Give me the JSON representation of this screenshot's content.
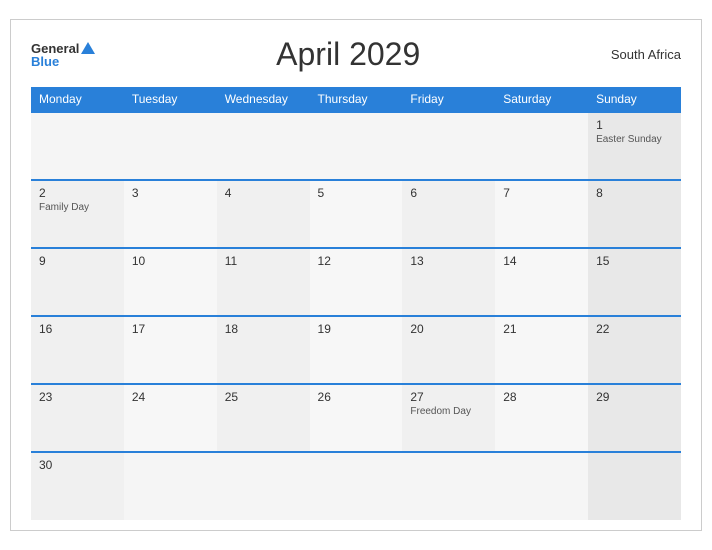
{
  "header": {
    "logo_general": "General",
    "logo_blue": "Blue",
    "month_title": "April 2029",
    "country": "South Africa"
  },
  "weekdays": [
    "Monday",
    "Tuesday",
    "Wednesday",
    "Thursday",
    "Friday",
    "Saturday",
    "Sunday"
  ],
  "weeks": [
    [
      {
        "day": "",
        "holiday": ""
      },
      {
        "day": "",
        "holiday": ""
      },
      {
        "day": "",
        "holiday": ""
      },
      {
        "day": "",
        "holiday": ""
      },
      {
        "day": "",
        "holiday": ""
      },
      {
        "day": "",
        "holiday": ""
      },
      {
        "day": "1",
        "holiday": "Easter Sunday"
      }
    ],
    [
      {
        "day": "2",
        "holiday": "Family Day"
      },
      {
        "day": "3",
        "holiday": ""
      },
      {
        "day": "4",
        "holiday": ""
      },
      {
        "day": "5",
        "holiday": ""
      },
      {
        "day": "6",
        "holiday": ""
      },
      {
        "day": "7",
        "holiday": ""
      },
      {
        "day": "8",
        "holiday": ""
      }
    ],
    [
      {
        "day": "9",
        "holiday": ""
      },
      {
        "day": "10",
        "holiday": ""
      },
      {
        "day": "11",
        "holiday": ""
      },
      {
        "day": "12",
        "holiday": ""
      },
      {
        "day": "13",
        "holiday": ""
      },
      {
        "day": "14",
        "holiday": ""
      },
      {
        "day": "15",
        "holiday": ""
      }
    ],
    [
      {
        "day": "16",
        "holiday": ""
      },
      {
        "day": "17",
        "holiday": ""
      },
      {
        "day": "18",
        "holiday": ""
      },
      {
        "day": "19",
        "holiday": ""
      },
      {
        "day": "20",
        "holiday": ""
      },
      {
        "day": "21",
        "holiday": ""
      },
      {
        "day": "22",
        "holiday": ""
      }
    ],
    [
      {
        "day": "23",
        "holiday": ""
      },
      {
        "day": "24",
        "holiday": ""
      },
      {
        "day": "25",
        "holiday": ""
      },
      {
        "day": "26",
        "holiday": ""
      },
      {
        "day": "27",
        "holiday": "Freedom Day"
      },
      {
        "day": "28",
        "holiday": ""
      },
      {
        "day": "29",
        "holiday": ""
      }
    ],
    [
      {
        "day": "30",
        "holiday": ""
      },
      {
        "day": "",
        "holiday": ""
      },
      {
        "day": "",
        "holiday": ""
      },
      {
        "day": "",
        "holiday": ""
      },
      {
        "day": "",
        "holiday": ""
      },
      {
        "day": "",
        "holiday": ""
      },
      {
        "day": "",
        "holiday": ""
      }
    ]
  ]
}
